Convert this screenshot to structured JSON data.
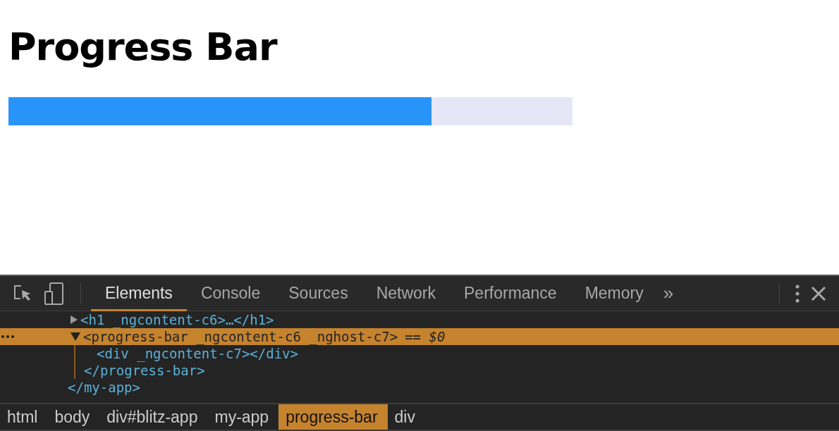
{
  "page": {
    "title": "Progress Bar",
    "progress": {
      "level": 0.75
    }
  },
  "devtools": {
    "tabs": [
      {
        "label": "Elements",
        "selected": true
      },
      {
        "label": "Console",
        "selected": false
      },
      {
        "label": "Sources",
        "selected": false
      },
      {
        "label": "Network",
        "selected": false
      },
      {
        "label": "Performance",
        "selected": false
      },
      {
        "label": "Memory",
        "selected": false
      }
    ],
    "overflow": "»",
    "dom_tree": [
      {
        "markup": "<h1 _ngcontent-c6>…</h1>",
        "expanded": false,
        "selected": false
      },
      {
        "markup": "<progress-bar _ngcontent-c6 _nghost-c7>",
        "suffix": "== $0",
        "expanded": true,
        "selected": true,
        "children": [
          {
            "markup": "<div _ngcontent-c7></div>"
          }
        ],
        "closing": "</progress-bar>"
      }
    ],
    "dom_tree_closing": "</my-app>",
    "breadcrumbs": [
      {
        "label": "html",
        "selected": false
      },
      {
        "label": "body",
        "selected": false
      },
      {
        "label": "div#blitz-app",
        "selected": false
      },
      {
        "label": "my-app",
        "selected": false
      },
      {
        "label": "progress-bar",
        "selected": true
      },
      {
        "label": "div",
        "selected": false
      }
    ]
  }
}
